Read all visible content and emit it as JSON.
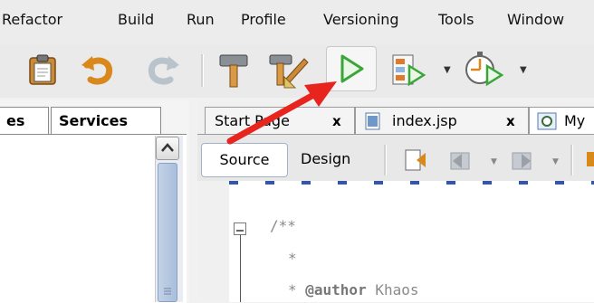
{
  "menu": {
    "items": [
      "Refactor",
      "Build",
      "Run",
      "Profile",
      "Versioning",
      "Tools",
      "Window"
    ]
  },
  "left_panel": {
    "tabs": [
      "es",
      "Services"
    ]
  },
  "editor": {
    "tabs": [
      {
        "label": "Start Page",
        "close": "x"
      },
      {
        "label": "index.jsp",
        "close": "x"
      },
      {
        "label": "My",
        "close": ""
      }
    ],
    "view_buttons": {
      "source": "Source",
      "design": "Design"
    },
    "code_lines": [
      "/**",
      "*",
      "* @author Khaos"
    ]
  },
  "colors": {
    "arrow": "#e8241f",
    "run_green": "#3aa63a",
    "selection_blue": "#9fb2cc"
  },
  "icons": [
    "paste-icon",
    "undo-icon",
    "redo-icon",
    "build-hammer-icon",
    "clean-build-icon",
    "run-icon",
    "debug-icon",
    "profile-icon"
  ]
}
